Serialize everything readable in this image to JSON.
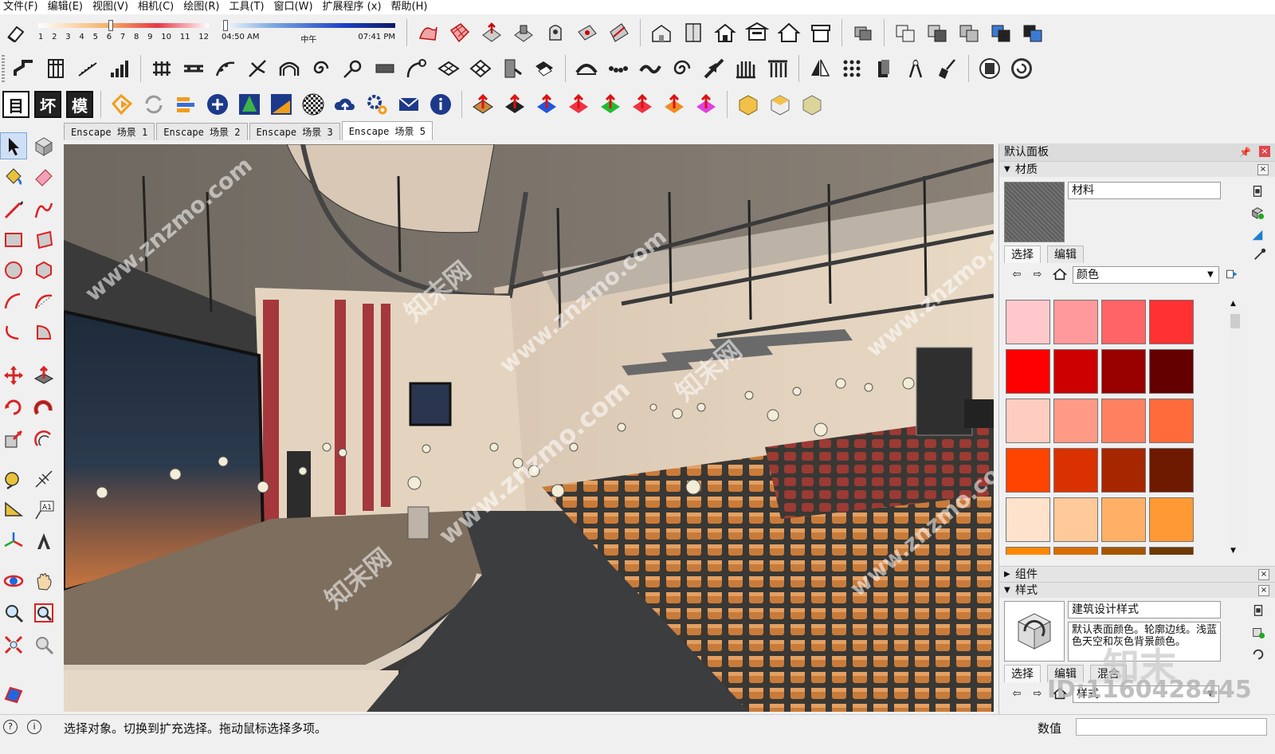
{
  "menu": [
    "文件(F)",
    "编辑(E)",
    "视图(V)",
    "相机(C)",
    "绘图(R)",
    "工具(T)",
    "窗口(W)",
    "扩展程序 (x)",
    "帮助(H)"
  ],
  "shadow": {
    "months": [
      "1",
      "2",
      "3",
      "4",
      "5",
      "6",
      "7",
      "8",
      "9",
      "10",
      "11",
      "12"
    ],
    "time_start": "04:50 AM",
    "time_mid": "中午",
    "time_end": "07:41 PM"
  },
  "toolbar3_text_buttons": [
    "目",
    "坏",
    "模"
  ],
  "scene_tabs": [
    "Enscape 场景 1",
    "Enscape 场景 2",
    "Enscape 场景 3",
    "Enscape 场景 5"
  ],
  "panel": {
    "title": "默认面板",
    "materials": {
      "header": "材质",
      "name": "材料",
      "tab_select": "选择",
      "tab_edit": "编辑",
      "library": "颜色",
      "colors": [
        "#ffc9cc",
        "#ff999c",
        "#ff6466",
        "#ff3132",
        "#ff0000",
        "#cc0000",
        "#990000",
        "#650000",
        "#ffccc1",
        "#ff9a86",
        "#ff8060",
        "#ff6b3a",
        "#ff4400",
        "#d93200",
        "#a62600",
        "#6e1a00",
        "#ffe2cc",
        "#ffc999",
        "#ffb066",
        "#ff9933",
        "#ff8800",
        "#d96d00",
        "#a65500",
        "#6e3900"
      ]
    },
    "components": {
      "header": "组件"
    },
    "styles": {
      "header": "样式",
      "name": "建筑设计样式",
      "description": "默认表面颜色。轮廓边线。浅蓝色天空和灰色背景颜色。",
      "tab_select": "选择",
      "tab_edit": "编辑",
      "tab_mix": "混合",
      "style_dropdown": "样式"
    }
  },
  "status": {
    "message": "选择对象。切换到扩充选择。拖动鼠标选择多项。",
    "measure_label": "数值"
  },
  "watermarks": [
    "www.znzmo.com",
    "知末网",
    "ID:1160428445",
    "知末"
  ]
}
